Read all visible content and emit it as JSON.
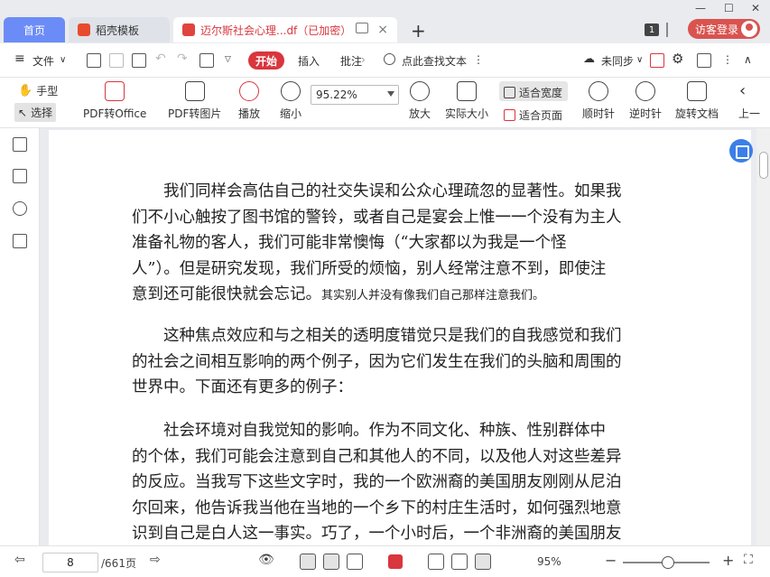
{
  "tabs": {
    "home": "首页",
    "daoke": "稻壳模板",
    "doc": "迈尔斯社会心理...df（已加密）",
    "add": "+",
    "close": "×",
    "badge": "1"
  },
  "window": {
    "login": "访客登录"
  },
  "menu": {
    "file": "文件",
    "file_arrow": "∨",
    "start": "开始",
    "insert": "插入",
    "annotate": "批注",
    "search": "点此查找文本",
    "sync": "未同步",
    "sync_arrow": "∨"
  },
  "toolbar": {
    "hand": "手型",
    "select": "选择",
    "pdf_to_office": "PDF转Office",
    "pdf_to_image": "PDF转图片",
    "play": "播放",
    "zoom_out": "缩小",
    "zoom_value": "95.22%",
    "zoom_in": "放大",
    "actual_size": "实际大小",
    "fit_width": "适合宽度",
    "fit_page": "适合页面",
    "clockwise": "顺时针",
    "counterclockwise": "逆时针",
    "rotate_doc": "旋转文档",
    "prev": "上一"
  },
  "document": {
    "paragraphs": [
      {
        "lines": [
          "　　我们同样会高估自己的社交失误和公众心理疏忽的显著性。如果我",
          "们不小心触按了图书馆的警铃，或者自己是宴会上惟一一个没有为主人",
          "准备礼物的客人，我们可能非常懊悔（“大家都以为我是一个怪",
          "人”）。但是研究发现，我们所受的烦恼，别人经常注意不到，即使注",
          "意到还可能很快就会忘记。"
        ],
        "tail_small": "其实别人并没有像我们自己那样注意我们。"
      },
      {
        "lines": [
          "　　这种焦点效应和与之相关的透明度错觉只是我们的自我感觉和我们",
          "的社会之间相互影响的两个例子，因为它们发生在我们的头脑和周围的",
          "世界中。下面还有更多的例子："
        ]
      },
      {
        "lines": [
          "　　社会环境对自我觉知的影响。作为不同文化、种族、性别群体中",
          "的个体，我们可能会注意到自己和其他人的不同，以及他人对这些差异",
          "的反应。当我写下这些文字时，我的一个欧洲裔的美国朋友刚刚从尼泊",
          "尔回来，他告诉我当他在当地的一个乡下的村庄生活时，如何强烈地意",
          "识到自己是白人这一事实。巧了，一个小时后，一个非洲裔的美国朋友"
        ]
      }
    ]
  },
  "status": {
    "page_current": "8",
    "page_total": "/661页",
    "zoom": "95%"
  }
}
